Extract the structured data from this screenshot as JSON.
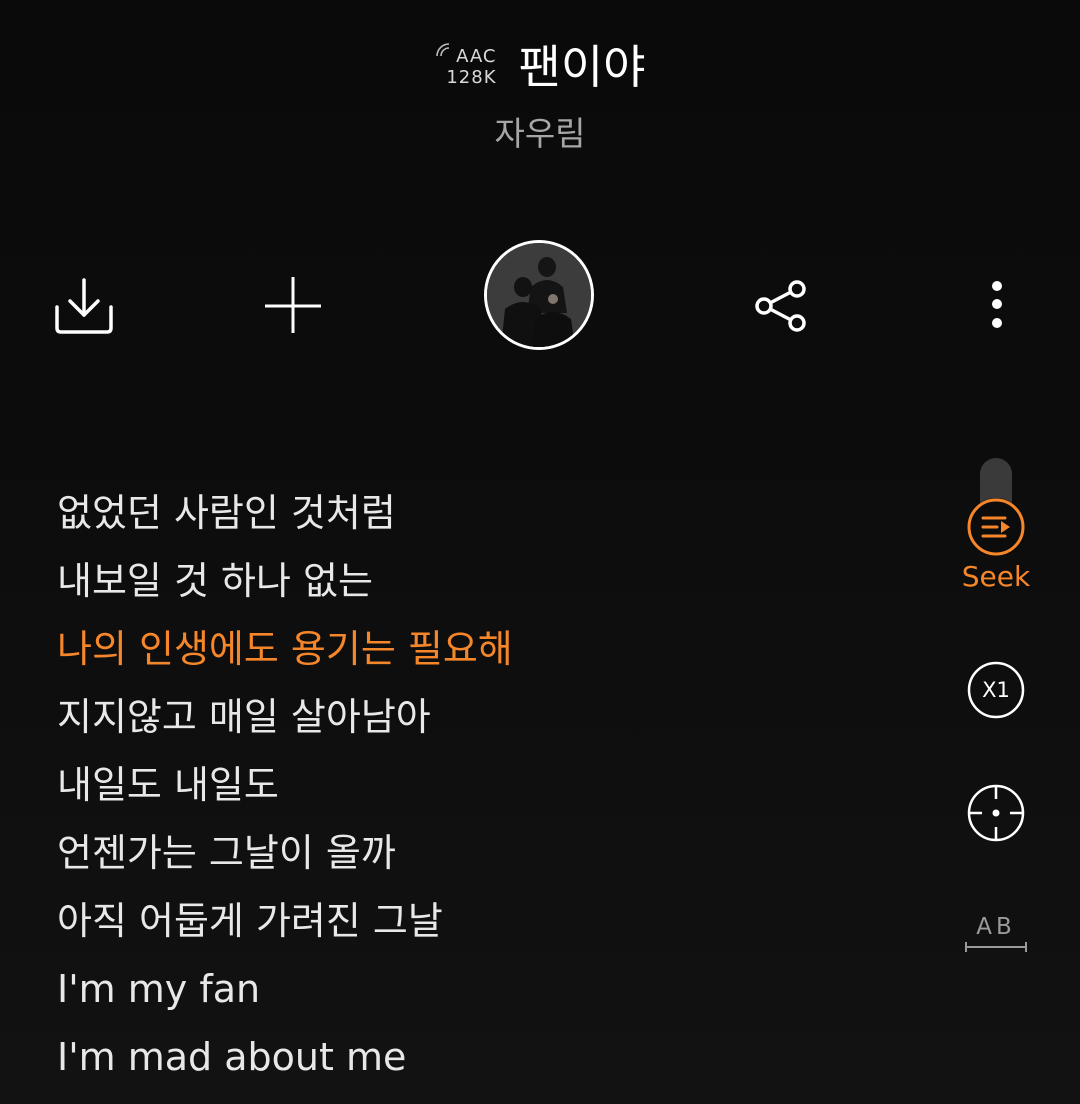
{
  "header": {
    "codec_line1": "AAC",
    "codec_line2": "128K",
    "title": "팬이야",
    "artist": "자우림"
  },
  "actions": [
    {
      "name": "download",
      "icon": "download-icon"
    },
    {
      "name": "add",
      "icon": "plus-icon"
    },
    {
      "name": "album-art",
      "icon": "album-art"
    },
    {
      "name": "share",
      "icon": "share-icon"
    },
    {
      "name": "more",
      "icon": "more-vertical-icon"
    }
  ],
  "lyrics": {
    "lines": [
      {
        "text": "없었던 사람인 것처럼",
        "active": false
      },
      {
        "text": "내보일 것 하나 없는",
        "active": false
      },
      {
        "text": "나의 인생에도 용기는 필요해",
        "active": true
      },
      {
        "text": "지지않고 매일 살아남아",
        "active": false
      },
      {
        "text": "내일도 내일도",
        "active": false
      },
      {
        "text": "언젠가는 그날이 올까",
        "active": false
      },
      {
        "text": "아직 어둡게 가려진 그날",
        "active": false
      },
      {
        "text": "I'm my fan",
        "active": false
      },
      {
        "text": "I'm mad about me",
        "active": false
      }
    ]
  },
  "side_controls": {
    "seek_icon": "seek-lyrics-icon",
    "seek_label": "Seek",
    "speed_label": "X1",
    "locate_icon": "crosshair-icon",
    "ab_label": "AB"
  },
  "colors": {
    "accent": "#f5862a",
    "background": "#0b0b0b",
    "text": "#e8e8e8",
    "muted": "#a6a6a6"
  }
}
